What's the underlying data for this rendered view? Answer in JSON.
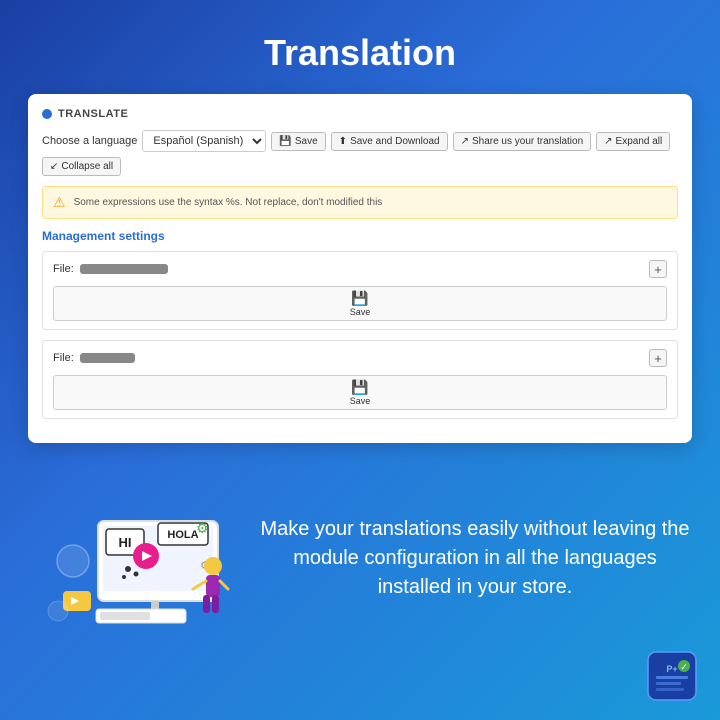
{
  "page": {
    "title": "Translation"
  },
  "translate": {
    "header_label": "TRANSLATE",
    "toolbar": {
      "choose_language_label": "Choose a language",
      "language_value": "Español (Spanish)",
      "save_label": "Save",
      "save_download_label": "Save and Download",
      "share_label": "Share us your translation",
      "expand_label": "Expand all",
      "collapse_label": "Collapse all"
    },
    "warning": {
      "text": "Some expressions use the syntax  %s. Not replace, don't modified this"
    },
    "management_settings_label": "Management settings",
    "files": [
      {
        "label": "File:",
        "name_bar_width": 88
      },
      {
        "label": "File:",
        "name_bar_width": 55
      }
    ],
    "save_button_label": "Save"
  },
  "promo": {
    "text": "Make your translations easily without leaving the module configuration in all the languages installed in your store."
  },
  "icons": {
    "save": "💾",
    "warning": "⚠",
    "share": "↗",
    "expand": "↗",
    "collapse": "↙",
    "save_disk": "⊞",
    "plus": "+"
  }
}
